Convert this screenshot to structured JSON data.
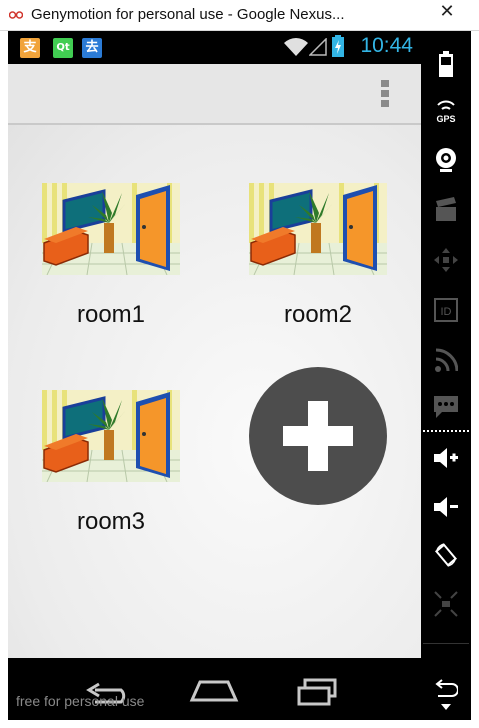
{
  "window": {
    "title": "Genymotion for personal use - Google Nexus...",
    "close_symbol": "✕"
  },
  "statusbar": {
    "time": "10:44",
    "notifications": [
      {
        "icon": "alipay-icon",
        "glyph": "支",
        "color": "#f1a33a"
      },
      {
        "icon": "qt-icon",
        "glyph": "Qt",
        "color": "#41cd52"
      },
      {
        "icon": "qunar-icon",
        "glyph": "去",
        "color": "#2b7bd6"
      }
    ],
    "accent_color": "#33b5e5"
  },
  "rooms": [
    {
      "label": "room1"
    },
    {
      "label": "room2"
    },
    {
      "label": "room3"
    }
  ],
  "navbar": {
    "watermark": "free for personal use"
  },
  "sidebar": {
    "tools": [
      "battery-icon",
      "gps-icon",
      "webcam-icon",
      "clapper-icon",
      "dpad-icon",
      "id-icon",
      "rss-icon",
      "sms-icon",
      "volume-up-icon",
      "volume-down-icon",
      "rotate-icon",
      "scale-icon",
      "back-icon",
      "menu-down-icon"
    ],
    "gps_label": "GPS",
    "id_label": "ID"
  }
}
